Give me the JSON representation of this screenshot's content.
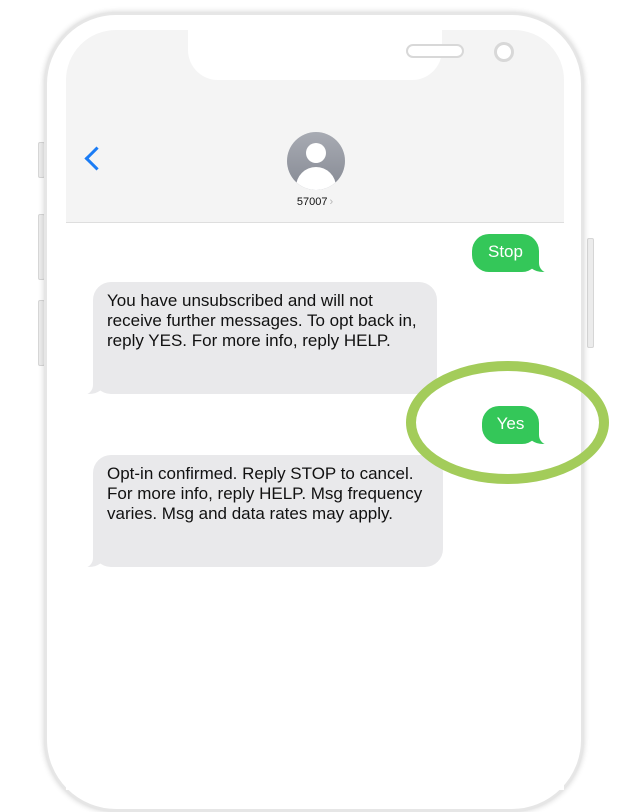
{
  "header": {
    "contact_name": "57007",
    "contact_chevron": "›",
    "back_icon": "chevron-left-icon",
    "avatar_icon": "person-placeholder-icon"
  },
  "messages": [
    {
      "direction": "outgoing",
      "text": "Stop"
    },
    {
      "direction": "incoming",
      "text": "You have unsubscribed and will not receive further messages. To opt back in, reply YES. For more info, reply HELP."
    },
    {
      "direction": "outgoing",
      "text": "Yes"
    },
    {
      "direction": "incoming",
      "text": "Opt-in confirmed. Reply STOP to cancel. For more info, reply HELP. Msg frequency varies. Msg and data rates may apply."
    }
  ],
  "colors": {
    "outgoing_bubble": "#34c759",
    "incoming_bubble": "#e9e9eb",
    "ios_blue": "#1a7cf5",
    "highlight_ring": "#a3cc5a"
  }
}
